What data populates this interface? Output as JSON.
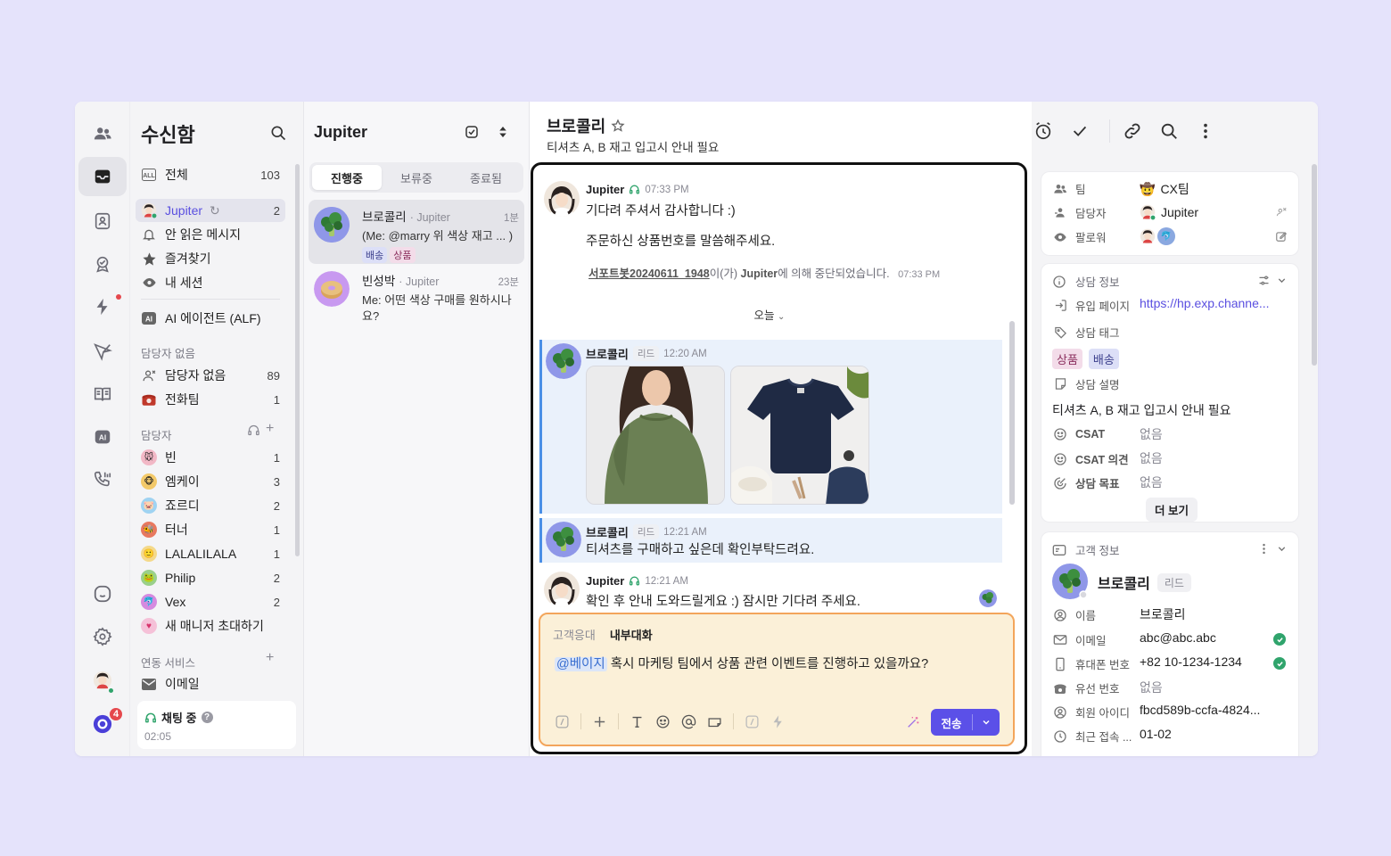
{
  "rail": {
    "items": [
      "contacts-icon",
      "inbox-icon",
      "profile-icon",
      "badge-icon",
      "bolt-icon",
      "send-icon",
      "book-icon",
      "ai-icon",
      "phone-icon",
      "chat-bubble-icon",
      "gear-icon",
      "my-avatar",
      "channel-logo"
    ],
    "notification_count": "4"
  },
  "inbox": {
    "title": "수신함",
    "items": [
      {
        "label": "전체",
        "count": "103"
      },
      {
        "label": "Jupiter",
        "count": "2"
      },
      {
        "label": "안 읽은 메시지",
        "count": ""
      },
      {
        "label": "즐겨찾기",
        "count": ""
      },
      {
        "label": "내 세션",
        "count": ""
      },
      {
        "label": "AI 에이전트 (ALF)",
        "count": ""
      }
    ],
    "unassigned_section": "담당자 없음",
    "unassigned_items": [
      {
        "label": "담당자 없음",
        "count": "89"
      },
      {
        "label": "전화팀",
        "count": "1"
      }
    ],
    "managers_section": "담당자",
    "managers": [
      {
        "label": "빈",
        "count": "1"
      },
      {
        "label": "엠케이",
        "count": "3"
      },
      {
        "label": "죠르디",
        "count": "2"
      },
      {
        "label": "터너",
        "count": "1"
      },
      {
        "label": "LALALILALA",
        "count": "1"
      },
      {
        "label": "Philip",
        "count": "2"
      },
      {
        "label": "Vex",
        "count": "2"
      },
      {
        "label": "새 매니저 초대하기",
        "count": ""
      }
    ],
    "integrations_section": "연동 서비스",
    "integrations": [
      {
        "label": "이메일"
      }
    ],
    "status": {
      "label": "채팅 중",
      "time": "02:05"
    }
  },
  "conv_list": {
    "title": "Jupiter",
    "tabs": [
      "진행중",
      "보류중",
      "종료됨"
    ],
    "items": [
      {
        "name": "브로콜리",
        "sub": "· Jupiter",
        "time": "1분",
        "msg": "(Me: @marry 위 색상 재고 ... )",
        "tags": [
          "배송",
          "상품"
        ]
      },
      {
        "name": "빈성박",
        "sub": "· Jupiter",
        "time": "23분",
        "msg": "Me: 어떤 색상 구매를 원하시나요?"
      }
    ]
  },
  "chat": {
    "title": "브로콜리",
    "subtitle": "티셔츠 A, B 재고 입고시 안내 필요",
    "messages": [
      {
        "name": "Jupiter",
        "time": "07:33 PM",
        "lines": [
          "기다려 주셔서 감사합니다 :)",
          "주문하신 상품번호를 말씀해주세요."
        ]
      },
      {
        "name": "브로콜리",
        "role": "리드",
        "time": "12:20 AM"
      },
      {
        "name": "브로콜리",
        "role": "리드",
        "time": "12:21 AM",
        "text": "티셔츠를 구매하고 싶은데 확인부탁드려요."
      },
      {
        "name": "Jupiter",
        "time": "12:21 AM",
        "text": "확인 후 안내 도와드릴게요 :) 잠시만 기다려 주세요."
      }
    ],
    "system": {
      "link": "서포트봇20240611_1948",
      "mid": "이(가) ",
      "actor": "Jupiter",
      "rest": "에 의해 중단되었습니다.",
      "time": "07:33 PM"
    },
    "day_separator": "오늘",
    "composer": {
      "tab_customer": "고객응대",
      "tab_internal": "내부대화",
      "mention": "@베이지",
      "text": " 혹시 마케팅 팀에서 상품 관련 이벤트를 진행하고 있을까요?",
      "send_label": "전송"
    }
  },
  "profile": {
    "team_label": "팀",
    "team_value": "CX팀",
    "assignee_label": "담당자",
    "assignee_value": "Jupiter",
    "follower_label": "팔로워",
    "consult_title": "상담 정보",
    "inflow_label": "유입 페이지",
    "inflow_value": "https://hp.exp.channe...",
    "tags_label": "상담 태그",
    "tags": [
      "상품",
      "배송"
    ],
    "desc_label": "상담 설명",
    "desc_value": "티셔츠 A, B 재고 입고시 안내 필요",
    "csat_label": "CSAT",
    "csat_value": "없음",
    "csat_opinion_label": "CSAT 의견",
    "csat_opinion_value": "없음",
    "goal_label": "상담 목표",
    "goal_value": "없음",
    "more_label": "더 보기",
    "customer_title": "고객 정보",
    "customer_name": "브로콜리",
    "customer_role": "리드",
    "name_label": "이름",
    "name_value": "브로콜리",
    "email_label": "이메일",
    "email_value": "abc@abc.abc",
    "mobile_label": "휴대폰 번호",
    "mobile_value": "+82 10-1234-1234",
    "landline_label": "유선 번호",
    "landline_value": "없음",
    "member_label": "회원 아이디",
    "member_value": "fbcd589b-ccfa-4824...",
    "last_access_label": "최근 접속 ...",
    "last_access_value": "01-02"
  },
  "colors": {
    "accent": "#5b50e8",
    "composer_bg": "#fbf0d8",
    "composer_border": "#f3a55b",
    "highlight_bg": "#eaf1fb",
    "online": "#30a46c"
  }
}
